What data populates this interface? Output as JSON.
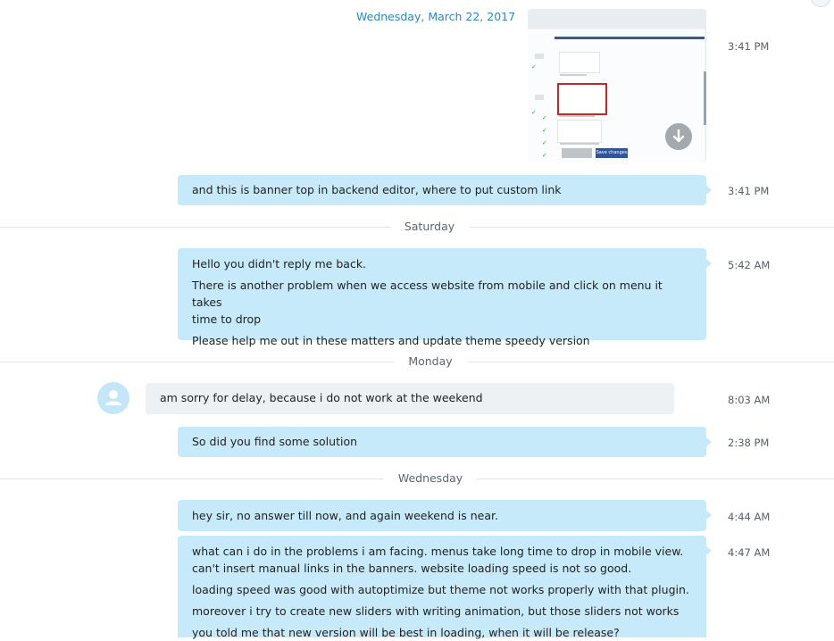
{
  "conversation": {
    "date_header": "Wednesday, March 22, 2017",
    "attachment": {
      "download_icon": "download-icon",
      "buttons": [
        "Save changes"
      ],
      "time": "3:41 PM"
    },
    "messages": [
      {
        "id": "m1",
        "direction": "outgoing",
        "time": "3:41 PM",
        "lines": [
          "and this is banner top in backend editor, where to put custom link"
        ]
      },
      {
        "id": "m2",
        "direction": "outgoing",
        "time": "5:42 AM",
        "lines": [
          "Hello you didn't reply me back.",
          "There is another problem when we access website from mobile and click on menu it takes",
          "time to drop",
          "Please help me out in these matters and update theme speedy version"
        ]
      },
      {
        "id": "m3",
        "direction": "incoming",
        "time": "8:03 AM",
        "lines": [
          "am sorry for delay, because i do not work at the weekend"
        ]
      },
      {
        "id": "m4",
        "direction": "outgoing",
        "time": "2:38 PM",
        "lines": [
          "So did you find some solution"
        ]
      },
      {
        "id": "m5",
        "direction": "outgoing",
        "time": "4:44 AM",
        "lines": [
          "hey sir, no answer till now, and again weekend is near."
        ]
      },
      {
        "id": "m6",
        "direction": "outgoing",
        "time": "4:47 AM",
        "lines": [
          "what can i do in the problems i am facing. menus take long time to drop in mobile view.",
          "can't insert manual links in the banners. website loading speed is not so good.",
          "loading speed was good with autoptimize but theme not works properly with that plugin.",
          "moreover i try to create new sliders with writing animation, but those sliders not works",
          "you told me that new version will be best in loading, when it will be release?"
        ]
      }
    ],
    "day_dividers": [
      "Saturday",
      "Monday",
      "Wednesday"
    ]
  },
  "colors": {
    "outgoing_bubble": "#c7eafb",
    "incoming_bubble": "#eef1f4",
    "date_link": "#2b88c8"
  }
}
